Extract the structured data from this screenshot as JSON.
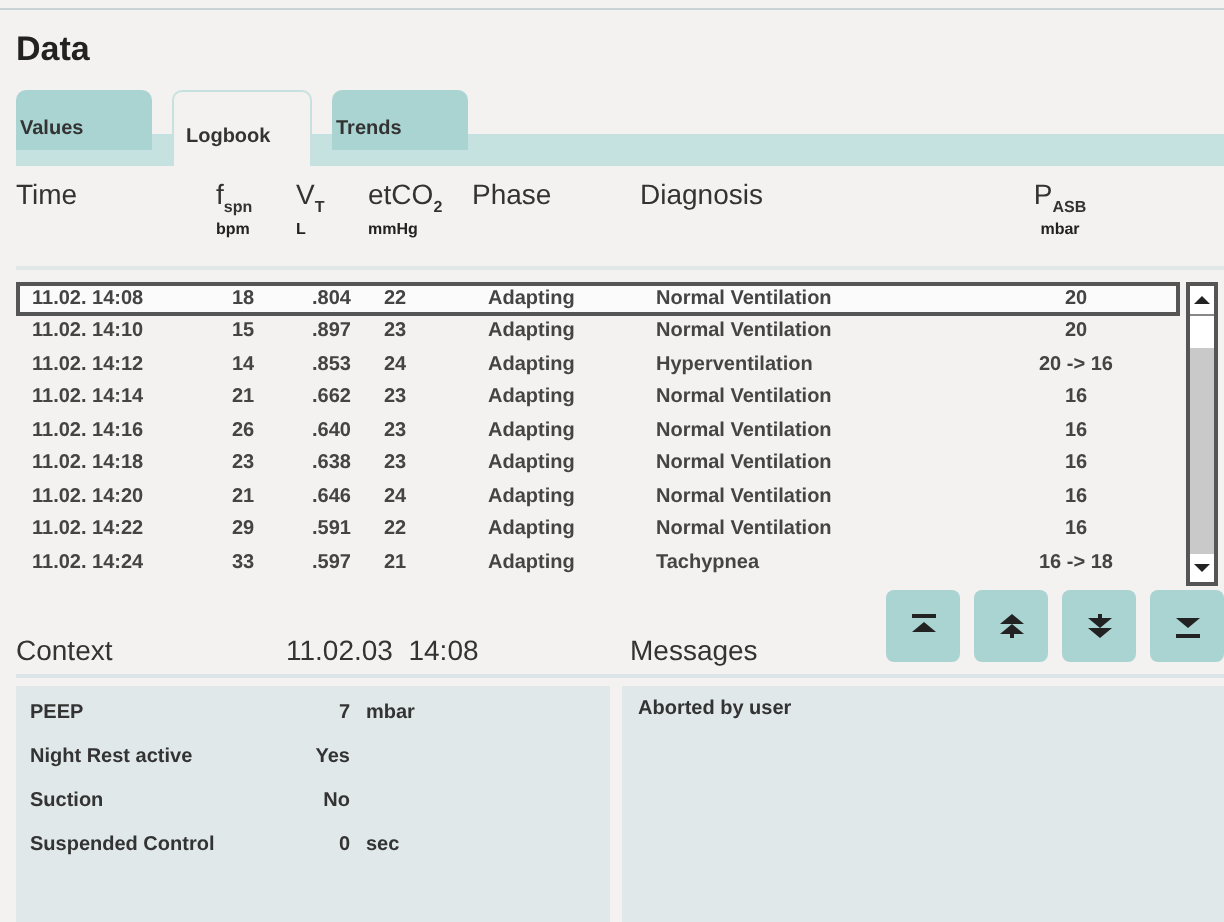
{
  "title": "Data",
  "tabs": [
    {
      "label": "Values",
      "selected": false
    },
    {
      "label": "Logbook",
      "selected": true
    },
    {
      "label": "Trends",
      "selected": false
    }
  ],
  "columns": [
    {
      "label": "Time"
    },
    {
      "label": "f$_{spn}$",
      "unit": "bpm"
    },
    {
      "label": "V$_{T}$",
      "unit": "L"
    },
    {
      "label": "etCO$_{2}$",
      "unit": "mmHg"
    },
    {
      "label": "Phase"
    },
    {
      "label": "Diagnosis"
    },
    {
      "label": "P$_{ASB}$",
      "unit": "mbar"
    }
  ],
  "rows": [
    {
      "cells": [
        "11.02. 14:08",
        "18",
        ".804",
        "22",
        "Adapting",
        "Normal Ventilation",
        "20"
      ],
      "selected": true
    },
    {
      "cells": [
        "11.02. 14:10",
        "15",
        ".897",
        "23",
        "Adapting",
        "Normal Ventilation",
        "20"
      ],
      "selected": false
    },
    {
      "cells": [
        "11.02. 14:12",
        "14",
        ".853",
        "24",
        "Adapting",
        "Hyperventilation",
        "20 -> 16"
      ],
      "selected": false
    },
    {
      "cells": [
        "11.02. 14:14",
        "21",
        ".662",
        "23",
        "Adapting",
        "Normal Ventilation",
        "16"
      ],
      "selected": false
    },
    {
      "cells": [
        "11.02. 14:16",
        "26",
        ".640",
        "23",
        "Adapting",
        "Normal Ventilation",
        "16"
      ],
      "selected": false
    },
    {
      "cells": [
        "11.02. 14:18",
        "23",
        ".638",
        "23",
        "Adapting",
        "Normal Ventilation",
        "16"
      ],
      "selected": false
    },
    {
      "cells": [
        "11.02. 14:20",
        "21",
        ".646",
        "24",
        "Adapting",
        "Normal Ventilation",
        "16"
      ],
      "selected": false
    },
    {
      "cells": [
        "11.02. 14:22",
        "29",
        ".591",
        "22",
        "Adapting",
        "Normal Ventilation",
        "16"
      ],
      "selected": false
    },
    {
      "cells": [
        "11.02. 14:24",
        "33",
        ".597",
        "21",
        "Adapting",
        "Tachypnea",
        "16 -> 18"
      ],
      "selected": false
    }
  ],
  "context": {
    "title": "Context",
    "timestamp": "11.02.03  14:08",
    "items": [
      {
        "label": "PEEP",
        "value": "7",
        "unit": "mbar"
      },
      {
        "label": "Night Rest active",
        "value": "Yes"
      },
      {
        "label": "Suction",
        "value": "No"
      },
      {
        "label": "Suspended Control",
        "value": "0",
        "unit": "sec"
      }
    ]
  },
  "messages": {
    "title": "Messages",
    "items": [
      "Aborted by user"
    ]
  },
  "nav_buttons": [
    {
      "kind": "first"
    },
    {
      "kind": "page-up"
    },
    {
      "kind": "page-down"
    },
    {
      "kind": "last"
    }
  ]
}
